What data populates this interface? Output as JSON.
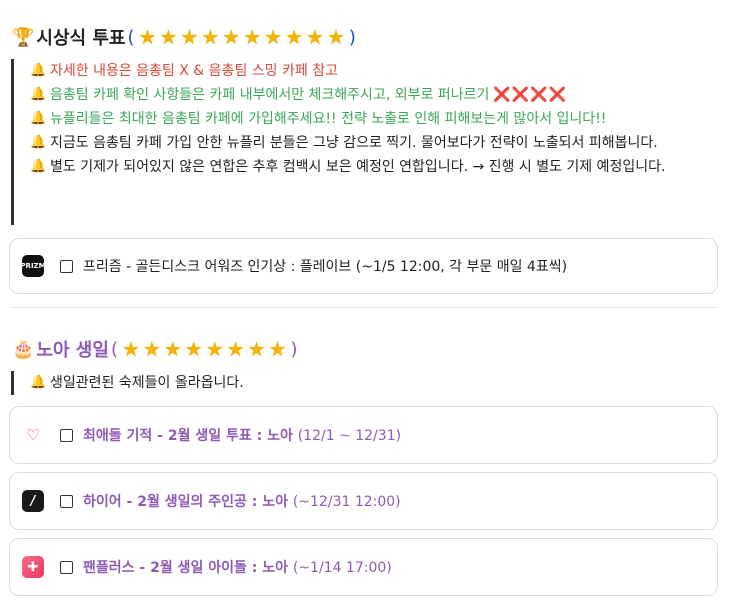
{
  "section1": {
    "emoji": "🏆",
    "title": "시상식 투표",
    "open_paren": "(",
    "close_paren": ")",
    "star_count": 10,
    "notes": [
      {
        "text": "자세한 내용은 음총팀 X & 음총팀 스밍 카페 참고",
        "color": "red"
      },
      {
        "text": "음총팀 카페 확인 사항들은 카페 내부에서만 체크해주시고, 외부로 퍼나르기",
        "color": "green",
        "suffix": "❌❌❌❌"
      },
      {
        "text": "뉴플리들은 최대한 음총팀 카페에 가입해주세요!! 전략 노출로 인해 피해보는게 많아서 입니다!!",
        "color": "green"
      },
      {
        "text": "지금도 음총팀 카페 가입 안한 뉴플리 분들은 그냥 감으로 찍기. 물어보다가 전략이 노출되서 피해봅니다.",
        "color": "black"
      },
      {
        "text": "별도 기제가 되어있지 않은 연합은 추후 컴백시 보은 예정인 연합입니다. → 진행 시 별도 기제 예정입니다.",
        "color": "black"
      }
    ],
    "cards": [
      {
        "icon": "prizm-icon",
        "icon_text": "PRIZM",
        "text": "프리즘 - 골든디스크 어워즈 인기상 : 플레이브 (~1/5 12:00, 각 부문 매일 4표씩)"
      }
    ]
  },
  "section2": {
    "emoji": "🎂",
    "title": "노아 생일",
    "open_paren": "(",
    "close_paren": ")",
    "star_count": 8,
    "notes": [
      {
        "text": "생일관련된 숙제들이 올라옵니다.",
        "color": "black"
      }
    ],
    "cards": [
      {
        "icon": "choeaedol-icon",
        "title": "최애돌 기적 - 2월 생일 투표 : 노아",
        "sub": "(12/1 ~ 12/31)"
      },
      {
        "icon": "hiare-icon",
        "title": "하이어 - 2월 생일의 주인공 : 노아",
        "sub": "(~12/31 12:00)"
      },
      {
        "icon": "fanplus-icon",
        "title": "팬플러스 - 2월 생일 아이돌 : 노아",
        "sub": "(~1/14 17:00)"
      }
    ]
  },
  "colors": {
    "red": "#d9483b",
    "green": "#3aa65a",
    "purple": "#8e5ab4",
    "star": "#f5b400"
  }
}
